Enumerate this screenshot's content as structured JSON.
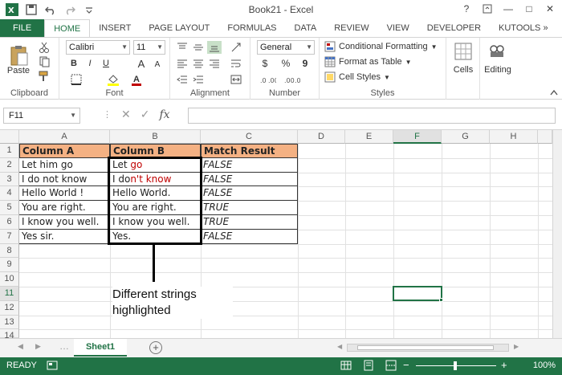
{
  "window": {
    "title": "Book21 - Excel",
    "help": "?",
    "minimize": "—",
    "restore": "□",
    "close": "✕"
  },
  "tabs": [
    "FILE",
    "HOME",
    "INSERT",
    "PAGE LAYOUT",
    "FORMULAS",
    "DATA",
    "REVIEW",
    "VIEW",
    "DEVELOPER",
    "KUTOOLS »"
  ],
  "ribbon": {
    "clipboard": {
      "paste": "Paste",
      "label": "Clipboard"
    },
    "font": {
      "name": "Calibri",
      "size": "11",
      "bold": "B",
      "italic": "I",
      "underline": "U",
      "grow": "A",
      "shrink": "A",
      "label": "Font"
    },
    "alignment": {
      "label": "Alignment"
    },
    "number": {
      "format": "General",
      "currency": "$",
      "percent": "%",
      "comma": "9",
      "label": "Number"
    },
    "styles": {
      "conditional": "Conditional Formatting",
      "table": "Format as Table",
      "cell": "Cell Styles",
      "label": "Styles"
    },
    "cells": {
      "label": "Cells"
    },
    "editing": {
      "label": "Editing"
    }
  },
  "formula_bar": {
    "name_box": "F11",
    "fx": "fx",
    "value": ""
  },
  "grid": {
    "columns": [
      "A",
      "B",
      "C",
      "D",
      "E",
      "F",
      "G",
      "H"
    ],
    "selected_column": "F",
    "rows": [
      "1",
      "2",
      "3",
      "4",
      "5",
      "6",
      "7",
      "8",
      "9",
      "10",
      "11",
      "12",
      "13",
      "14"
    ],
    "selected_row": "11",
    "headers": [
      "Column A",
      "Column B",
      "Match Result"
    ],
    "col_a": [
      "Let him go",
      "I do not know",
      "Hello World !",
      "You are right.",
      "I know you well.",
      "Yes sir."
    ],
    "col_b": [
      {
        "plain": "Let ",
        "diff": "go"
      },
      {
        "plain": "I do",
        "diff": "n't know"
      },
      {
        "plain": "Hello World.",
        "diff": ""
      },
      {
        "plain": "You are right.",
        "diff": ""
      },
      {
        "plain": "I know you well.",
        "diff": ""
      },
      {
        "plain": "Yes.",
        "diff": ""
      }
    ],
    "col_c": [
      "FALSE",
      "FALSE",
      "FALSE",
      "TRUE",
      "TRUE",
      "FALSE"
    ]
  },
  "annotation": {
    "line1": "Different strings",
    "line2": "highlighted"
  },
  "sheet_tab": "Sheet1",
  "status": {
    "ready": "READY",
    "zoom": "100%"
  },
  "colors": {
    "excel_green": "#217346",
    "header_fill": "#f4b183",
    "diff_red": "#c00000"
  }
}
